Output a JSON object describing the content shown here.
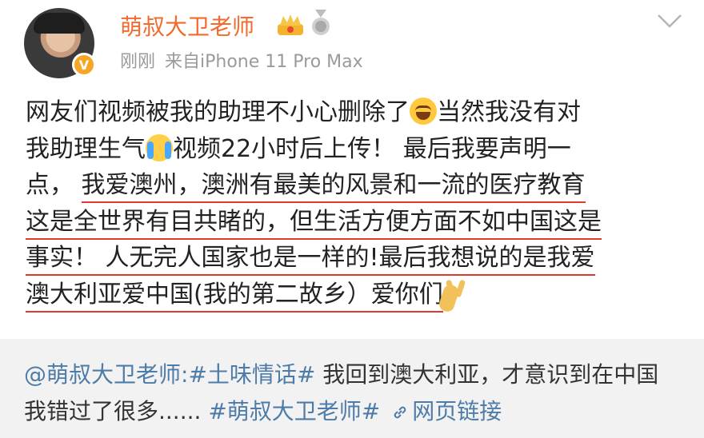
{
  "user": {
    "name": "萌叔大卫老师",
    "time": "刚刚",
    "source": "来自iPhone 11 Pro Max"
  },
  "post": {
    "p1": "网友们视频被我的助理不小心删除了",
    "p2": "当然我没有对",
    "p3": "我助理生气",
    "p4": "视频22小时后上传！ 最后我要声明一",
    "p5": "点，",
    "u1": "我爱澳州，澳洲有最美的风景和一流的医疗教育",
    "u2": "这是全世界有目共睹的，但生活方便方面不如中国这是",
    "u3": "事实！ 人无完人国家也是一样的!最后我想说的是我爱",
    "u4": "澳大利亚爱中国(我的第二故乡）爱你们"
  },
  "repost": {
    "author": "@萌叔大卫老师:",
    "topic1": "#土味情话#",
    "text": " 我回到澳大利亚，才意识到在中国我错过了很多......",
    "topic2": "#萌叔大卫老师#",
    "weblink": "网页链接"
  },
  "icons": {
    "crown": "crown-badge-icon",
    "medal": "medal-badge-icon",
    "verified": "verified-v-icon",
    "chevron": "chevron-down-icon",
    "link": "link-icon"
  },
  "colors": {
    "username": "#f26b2c",
    "link": "#4e7ca8",
    "underline": "#e0392f",
    "repost_bg": "#f2f2f2"
  }
}
